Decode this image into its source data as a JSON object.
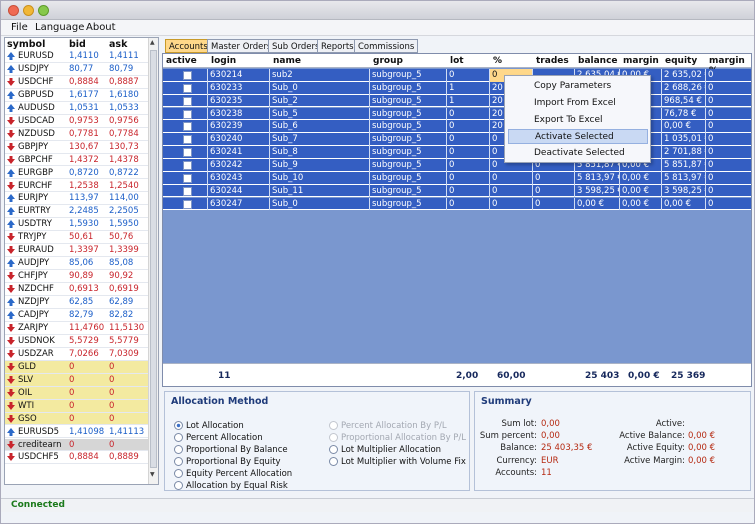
{
  "menu": {
    "file": "File",
    "language": "Language",
    "about": "About"
  },
  "quotes": {
    "headers": {
      "symbol": "symbol",
      "bid": "bid",
      "ask": "ask"
    },
    "rows": [
      {
        "symbol": "EURUSD",
        "bid": "1,4110",
        "ask": "1,4111",
        "dir": "up"
      },
      {
        "symbol": "USDJPY",
        "bid": "80,77",
        "ask": "80,79",
        "dir": "up"
      },
      {
        "symbol": "USDCHF",
        "bid": "0,8884",
        "ask": "0,8887",
        "dir": "down"
      },
      {
        "symbol": "GBPUSD",
        "bid": "1,6177",
        "ask": "1,6180",
        "dir": "up"
      },
      {
        "symbol": "AUDUSD",
        "bid": "1,0531",
        "ask": "1,0533",
        "dir": "up"
      },
      {
        "symbol": "USDCAD",
        "bid": "0,9753",
        "ask": "0,9756",
        "dir": "down"
      },
      {
        "symbol": "NZDUSD",
        "bid": "0,7781",
        "ask": "0,7784",
        "dir": "down"
      },
      {
        "symbol": "GBPJPY",
        "bid": "130,67",
        "ask": "130,73",
        "dir": "down"
      },
      {
        "symbol": "GBPCHF",
        "bid": "1,4372",
        "ask": "1,4378",
        "dir": "down"
      },
      {
        "symbol": "EURGBP",
        "bid": "0,8720",
        "ask": "0,8722",
        "dir": "up"
      },
      {
        "symbol": "EURCHF",
        "bid": "1,2538",
        "ask": "1,2540",
        "dir": "down"
      },
      {
        "symbol": "EURJPY",
        "bid": "113,97",
        "ask": "114,00",
        "dir": "up"
      },
      {
        "symbol": "EURTRY",
        "bid": "2,2485",
        "ask": "2,2505",
        "dir": "up"
      },
      {
        "symbol": "USDTRY",
        "bid": "1,5930",
        "ask": "1,5950",
        "dir": "up"
      },
      {
        "symbol": "TRYJPY",
        "bid": "50,61",
        "ask": "50,76",
        "dir": "down"
      },
      {
        "symbol": "EURAUD",
        "bid": "1,3397",
        "ask": "1,3399",
        "dir": "down"
      },
      {
        "symbol": "AUDJPY",
        "bid": "85,06",
        "ask": "85,08",
        "dir": "up"
      },
      {
        "symbol": "CHFJPY",
        "bid": "90,89",
        "ask": "90,92",
        "dir": "down"
      },
      {
        "symbol": "NZDCHF",
        "bid": "0,6913",
        "ask": "0,6919",
        "dir": "down"
      },
      {
        "symbol": "NZDJPY",
        "bid": "62,85",
        "ask": "62,89",
        "dir": "up"
      },
      {
        "symbol": "CADJPY",
        "bid": "82,79",
        "ask": "82,82",
        "dir": "up"
      },
      {
        "symbol": "ZARJPY",
        "bid": "11,4760",
        "ask": "11,5130",
        "dir": "down"
      },
      {
        "symbol": "USDNOK",
        "bid": "5,5729",
        "ask": "5,5779",
        "dir": "down"
      },
      {
        "symbol": "USDZAR",
        "bid": "7,0266",
        "ask": "7,0309",
        "dir": "down"
      },
      {
        "symbol": "GLD",
        "bid": "0",
        "ask": "0",
        "dir": "down",
        "hl": "yellow"
      },
      {
        "symbol": "SLV",
        "bid": "0",
        "ask": "0",
        "dir": "down",
        "hl": "yellow"
      },
      {
        "symbol": "OIL",
        "bid": "0",
        "ask": "0",
        "dir": "down",
        "hl": "yellow"
      },
      {
        "symbol": "WTI",
        "bid": "0",
        "ask": "0",
        "dir": "down",
        "hl": "yellow"
      },
      {
        "symbol": "GSO",
        "bid": "0",
        "ask": "0",
        "dir": "down",
        "hl": "yellow"
      },
      {
        "symbol": "EURUSD5",
        "bid": "1,41098",
        "ask": "1,41113",
        "dir": "up"
      },
      {
        "symbol": "creditearn",
        "bid": "0",
        "ask": "0",
        "dir": "down",
        "hl": "gray"
      },
      {
        "symbol": "USDCHF5",
        "bid": "0,8884",
        "ask": "0,8889",
        "dir": "down"
      }
    ]
  },
  "tabs": [
    "Accounts",
    "Master Orders",
    "Sub Orders",
    "Reports",
    "Commissions"
  ],
  "grid": {
    "headers": {
      "active": "active",
      "login": "login",
      "name": "name",
      "group": "group",
      "lot": "lot",
      "pct": "%",
      "trades": "trades",
      "balance": "balance",
      "margin": "margin",
      "equity": "equity",
      "marginpct": "margin %"
    },
    "rows": [
      {
        "login": "630214",
        "name": "sub2",
        "group": "subgroup_5",
        "lot": "0",
        "pct": "0",
        "trades": "",
        "balance": "2 635,04 €",
        "margin": "0,00 €",
        "equity": "2 635,02 €",
        "mp": "0"
      },
      {
        "login": "630233",
        "name": "Sub_0",
        "group": "subgroup_5",
        "lot": "1",
        "pct": "20",
        "trades": "",
        "balance": "",
        "margin": "",
        "equity": "2 688,26 €",
        "mp": "0"
      },
      {
        "login": "630235",
        "name": "Sub_2",
        "group": "subgroup_5",
        "lot": "1",
        "pct": "20",
        "trades": "",
        "balance": "",
        "margin": "",
        "equity": "968,54 €",
        "mp": "0"
      },
      {
        "login": "630238",
        "name": "Sub_5",
        "group": "subgroup_5",
        "lot": "0",
        "pct": "20",
        "trades": "",
        "balance": "",
        "margin": "",
        "equity": "76,78 €",
        "mp": "0"
      },
      {
        "login": "630239",
        "name": "Sub_6",
        "group": "subgroup_5",
        "lot": "0",
        "pct": "20",
        "trades": "",
        "balance": "",
        "margin": "",
        "equity": "0,00 €",
        "mp": "0"
      },
      {
        "login": "630240",
        "name": "Sub_7",
        "group": "subgroup_5",
        "lot": "0",
        "pct": "0",
        "trades": "",
        "balance": "",
        "margin": "",
        "equity": "1 035,01 €",
        "mp": "0"
      },
      {
        "login": "630241",
        "name": "Sub_8",
        "group": "subgroup_5",
        "lot": "0",
        "pct": "0",
        "trades": "",
        "balance": "",
        "margin": "",
        "equity": "2 701,88 €",
        "mp": "0"
      },
      {
        "login": "630242",
        "name": "Sub_9",
        "group": "subgroup_5",
        "lot": "0",
        "pct": "0",
        "trades": "0",
        "balance": "5 851,87 €",
        "margin": "0,00 €",
        "equity": "5 851,87 €",
        "mp": "0"
      },
      {
        "login": "630243",
        "name": "Sub_10",
        "group": "subgroup_5",
        "lot": "0",
        "pct": "0",
        "trades": "0",
        "balance": "5 813,97 €",
        "margin": "0,00 €",
        "equity": "5 813,97 €",
        "mp": "0"
      },
      {
        "login": "630244",
        "name": "Sub_11",
        "group": "subgroup_5",
        "lot": "0",
        "pct": "0",
        "trades": "0",
        "balance": "3 598,25 €",
        "margin": "0,00 €",
        "equity": "3 598,25 €",
        "mp": "0"
      },
      {
        "login": "630247",
        "name": "Sub_0",
        "group": "subgroup_5",
        "lot": "0",
        "pct": "0",
        "trades": "0",
        "balance": "0,00 €",
        "margin": "0,00 €",
        "equity": "0,00 €",
        "mp": "0"
      }
    ],
    "footer": {
      "count": "11",
      "lot": "2,00",
      "pct": "60,00",
      "balance": "25 403",
      "margin": "0,00 €",
      "equity": "25 369"
    }
  },
  "context_menu": [
    "Copy Parameters",
    "Import From Excel",
    "Export To Excel",
    "Activate Selected",
    "Deactivate Selected"
  ],
  "allocation": {
    "title": "Allocation Method",
    "left": [
      "Lot Allocation",
      "Percent Allocation",
      "Proportional By Balance",
      "Proportional By Equity",
      "Equity Percent Allocation",
      "Allocation by Equal Risk"
    ],
    "right": [
      "Percent Allocation By P/L",
      "Proportional Allocation By P/L",
      "Lot Multiplier Allocation",
      "Lot Multiplier with Volume Fix"
    ]
  },
  "summary": {
    "title": "Summary",
    "left": [
      {
        "label": "Sum lot:",
        "value": "0,00"
      },
      {
        "label": "Sum percent:",
        "value": "0,00"
      },
      {
        "label": "Balance:",
        "value": "25 403,35 €"
      },
      {
        "label": "Currency:",
        "value": "EUR"
      },
      {
        "label": "Accounts:",
        "value": "11"
      }
    ],
    "right": [
      {
        "label": "Active:",
        "value": ""
      },
      {
        "label": "Active Balance:",
        "value": "0,00 €"
      },
      {
        "label": "Active Equity:",
        "value": "0,00 €"
      },
      {
        "label": "Active Margin:",
        "value": "0,00 €"
      }
    ]
  },
  "status": "Connected",
  "colors": {
    "up": "#1b5ec8",
    "down": "#c8242b",
    "row": "#345ec2",
    "tab_active": "#ffd88a"
  }
}
